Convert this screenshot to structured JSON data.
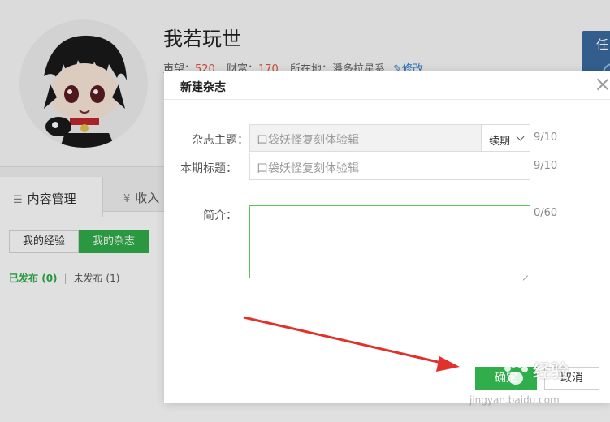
{
  "profile": {
    "username": "我若玩世",
    "stats": {
      "prestige_label": "声望：",
      "prestige_value": "520",
      "wealth_label": "财富：",
      "wealth_value": "170",
      "location_label": "所在地：",
      "location_value": "潘多拉星系",
      "edit_label": "修改"
    }
  },
  "side_promo": {
    "text": "任"
  },
  "tabs": [
    {
      "label": "内容管理",
      "icon": "list-icon"
    },
    {
      "label": "收入",
      "icon": "currency-icon"
    }
  ],
  "subtabs": [
    {
      "label": "我的经验"
    },
    {
      "label": "我的杂志"
    }
  ],
  "filters": {
    "published_label": "已发布",
    "published_count": "(0)",
    "unpublished_label": "未发布",
    "unpublished_count": "(1)"
  },
  "modal": {
    "title": "新建杂志",
    "topic": {
      "label": "杂志主题：",
      "value": "口袋妖怪复刻体验辑",
      "select_value": "续期",
      "counter": "9/10"
    },
    "issue": {
      "label": "本期标题：",
      "value": "口袋妖怪复刻体验辑",
      "counter": "9/10"
    },
    "intro": {
      "label": "简介：",
      "value": "",
      "counter": "0/60"
    },
    "ok_label": "确定",
    "cancel_label": "取消"
  },
  "watermark": {
    "text": "经验",
    "url": "jingyan.baidu.com"
  },
  "colors": {
    "accent_green": "#2fae4b",
    "focus_green": "#5cc25d",
    "stat_red": "#e4563c",
    "link_blue": "#2a7bd1",
    "arrow_red": "#e0322a"
  }
}
